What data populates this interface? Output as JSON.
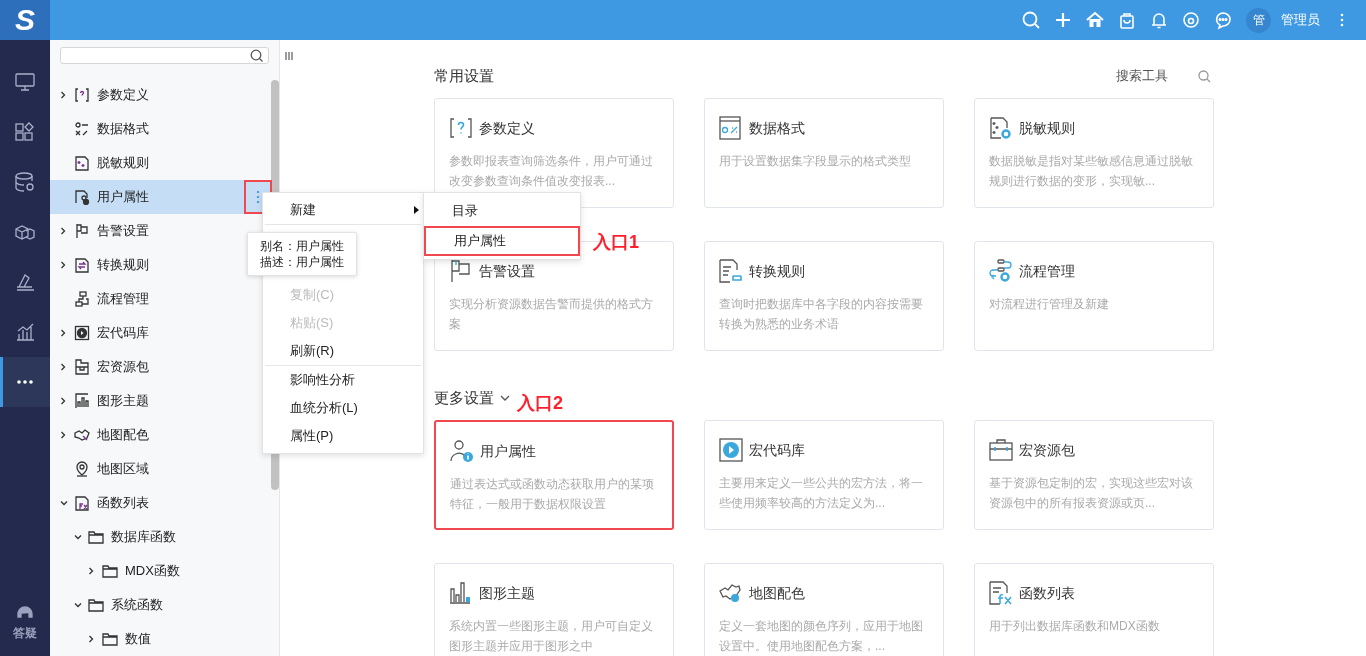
{
  "header": {
    "logo": "S",
    "avatar": "管",
    "user": "管理员"
  },
  "rail": {
    "items": [
      {
        "selected": false
      },
      {
        "selected": false
      },
      {
        "selected": false
      },
      {
        "selected": false
      },
      {
        "selected": false
      },
      {
        "selected": false
      },
      {
        "selected": true
      }
    ],
    "help": "答疑"
  },
  "tree": {
    "items": [
      {
        "label": "参数定义",
        "expanded": false,
        "selected": false
      },
      {
        "label": "数据格式",
        "selected": false
      },
      {
        "label": "脱敏规则",
        "selected": false
      },
      {
        "label": "用户属性",
        "selected": true
      },
      {
        "label": "告警设置",
        "expanded": false,
        "selected": false
      },
      {
        "label": "转换规则",
        "expanded": false,
        "selected": false
      },
      {
        "label": "流程管理",
        "selected": false
      },
      {
        "label": "宏代码库",
        "expanded": false,
        "selected": false
      },
      {
        "label": "宏资源包",
        "expanded": false,
        "selected": false
      },
      {
        "label": "图形主题",
        "expanded": false,
        "selected": false
      },
      {
        "label": "地图配色",
        "expanded": false,
        "selected": false
      },
      {
        "label": "地图区域",
        "selected": false
      },
      {
        "label": "函数列表",
        "expanded": true,
        "selected": false,
        "children": [
          {
            "label": "数据库函数",
            "expanded": true,
            "selected": false,
            "children": [
              {
                "label": "MDX函数",
                "expanded": false,
                "selected": false
              }
            ]
          },
          {
            "label": "系统函数",
            "expanded": true,
            "selected": false,
            "children": [
              {
                "label": "数值",
                "expanded": false,
                "selected": false
              }
            ]
          }
        ]
      }
    ]
  },
  "tooltip": {
    "lines": [
      "别名：用户属性",
      "描述：用户属性"
    ]
  },
  "context_menu": {
    "trigger_marked": true,
    "items": [
      {
        "kind": "submenu",
        "label": "新建",
        "disabled": false
      },
      {
        "kind": "separator"
      },
      {
        "kind": "covered"
      },
      {
        "kind": "covered"
      },
      {
        "kind": "item",
        "label": "复制(C)",
        "disabled": true
      },
      {
        "kind": "item",
        "label": "粘贴(S)",
        "disabled": true
      },
      {
        "kind": "item",
        "label": "刷新(R)",
        "disabled": false
      },
      {
        "kind": "separator"
      },
      {
        "kind": "item",
        "label": "影响性分析",
        "disabled": false
      },
      {
        "kind": "item",
        "label": "血统分析(L)",
        "disabled": false
      },
      {
        "kind": "item",
        "label": "属性(P)",
        "disabled": false
      }
    ],
    "submenu": {
      "annotation": "入口1",
      "items": [
        {
          "label": "目录",
          "marked": false
        },
        {
          "label": "用户属性",
          "marked": true
        }
      ]
    }
  },
  "search_tools": "搜索工具",
  "sections": [
    {
      "kind": "plain",
      "title": "常用设置",
      "cards": [
        {
          "title": "参数定义",
          "description": "参数即报表查询筛选条件，用户可通过改变参数查询条件值改变报表...",
          "marked": false
        },
        {
          "title": "数据格式",
          "description": "用于设置数据集字段显示的格式类型",
          "marked": false
        },
        {
          "title": "脱敏规则",
          "description": "数据脱敏是指对某些敏感信息通过脱敏规则进行数据的变形，实现敏...",
          "marked": false
        },
        {
          "title": "告警设置",
          "description": "实现分析资源数据告警而提供的格式方案",
          "marked": false
        },
        {
          "title": "转换规则",
          "description": "查询时把数据库中各字段的内容按需要转换为熟悉的业务术语",
          "marked": false
        },
        {
          "title": "流程管理",
          "description": "对流程进行管理及新建",
          "marked": false
        }
      ]
    },
    {
      "kind": "collapsible",
      "title": "更多设置",
      "expanded": true,
      "annotation": "入口2",
      "cards": [
        {
          "title": "用户属性",
          "description": "通过表达式或函数动态获取用户的某项特征，一般用于数据权限设置",
          "marked": true
        },
        {
          "title": "宏代码库",
          "description": "主要用来定义一些公共的宏方法，将一些使用频率较高的方法定义为...",
          "marked": false
        },
        {
          "title": "宏资源包",
          "description": "基于资源包定制的宏，实现这些宏对该资源包中的所有报表资源或页...",
          "marked": false
        },
        {
          "title": "图形主题",
          "description": "系统内置一些图形主题，用户可自定义图形主题并应用于图形之中",
          "marked": false
        },
        {
          "title": "地图配色",
          "description": "定义一套地图的颜色序列，应用于地图设置中。使用地图配色方案，...",
          "marked": false
        },
        {
          "title": "函数列表",
          "description": "用于列出数据库函数和MDX函数",
          "marked": false
        }
      ]
    }
  ]
}
